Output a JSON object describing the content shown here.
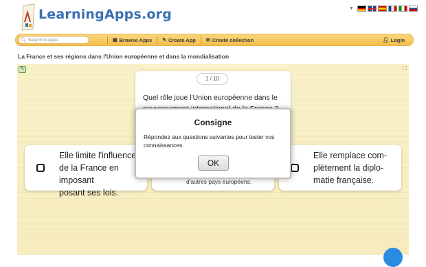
{
  "header": {
    "logo_text": "LearningApps.org",
    "languages": [
      "de",
      "gb",
      "es",
      "fr",
      "it",
      "ru"
    ]
  },
  "nav": {
    "search_placeholder": "Search in Apps",
    "browse": "Browse Apps",
    "create_app": "Create App",
    "create_collection": "Create collection",
    "login": "Login"
  },
  "page": {
    "title": "La France et ses régions dans l'Union européenne et dans la mondialisation"
  },
  "quiz": {
    "counter": "1 / 10",
    "question_line1": "Quel rôle joue l'Union européenne dans le",
    "question_line2": "gouvernement international de la France ?",
    "answers": [
      {
        "line1": "Elle limite l'influence",
        "line2": "de la France en imposant",
        "line3": "posant ses lois."
      },
      {
        "small": "d'autres pays européens."
      },
      {
        "line1": "Elle remplace com-",
        "line2": "plètement la diplo-",
        "line3": "matie française."
      }
    ]
  },
  "modal": {
    "title": "Consigne",
    "body": "Répondez aux questions suivantes pour tester vos connaissances.",
    "ok": "OK"
  },
  "colors": {
    "nav_bg": "#f3bd4d",
    "logo_blue": "#3b6fb3",
    "app_bg": "#f8f0c8"
  }
}
